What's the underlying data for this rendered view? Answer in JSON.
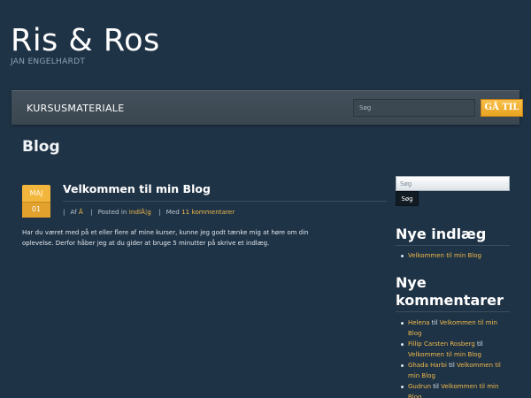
{
  "header": {
    "site_title": "Ris & Ros",
    "site_description": "JAN ENGELHARDT"
  },
  "nav": {
    "items": [
      "KURSUSMATERIALE"
    ],
    "search_placeholder": "Søg",
    "goto_label": "GÅ TIL"
  },
  "main": {
    "page_title": "Blog",
    "post": {
      "date_month": "MAJ",
      "date_day": "01",
      "title": "Velkommen til min Blog",
      "meta_author_prefix": "Af",
      "meta_author": "Å",
      "meta_posted_prefix": "Posted in",
      "meta_category": "IndlÅ¦g",
      "meta_comments_prefix": "Med",
      "meta_comments": "11 kommentarer",
      "body": "Har du været med på et eller flere af mine kurser, kunne jeg godt tænke mig at høre om din oplevelse. Derfor håber jeg at du gider at bruge 5 minutter på skrive et indlæg."
    }
  },
  "sidebar": {
    "search_placeholder": "Søg",
    "search_button": "Søg",
    "recent_posts_title": "Nye indlæg",
    "recent_posts": [
      "Velkommen til min Blog"
    ],
    "recent_comments_title": "Nye kommentarer",
    "recent_comments": [
      {
        "author": "Helena",
        "connector": "til",
        "post": "Velkommen til min Blog"
      },
      {
        "author": "Fillip Carsten Rosberg",
        "connector": "til",
        "post": "Velkommen til min Blog"
      },
      {
        "author": "Ghada Harbi",
        "connector": "til",
        "post": "Velkommen til min Blog"
      },
      {
        "author": "Gudrun",
        "connector": "til",
        "post": "Velkommen til min Blog"
      }
    ]
  },
  "colors": {
    "background": "#1f3346",
    "accent": "#f0b94a",
    "navbar": "#3f4b55"
  }
}
